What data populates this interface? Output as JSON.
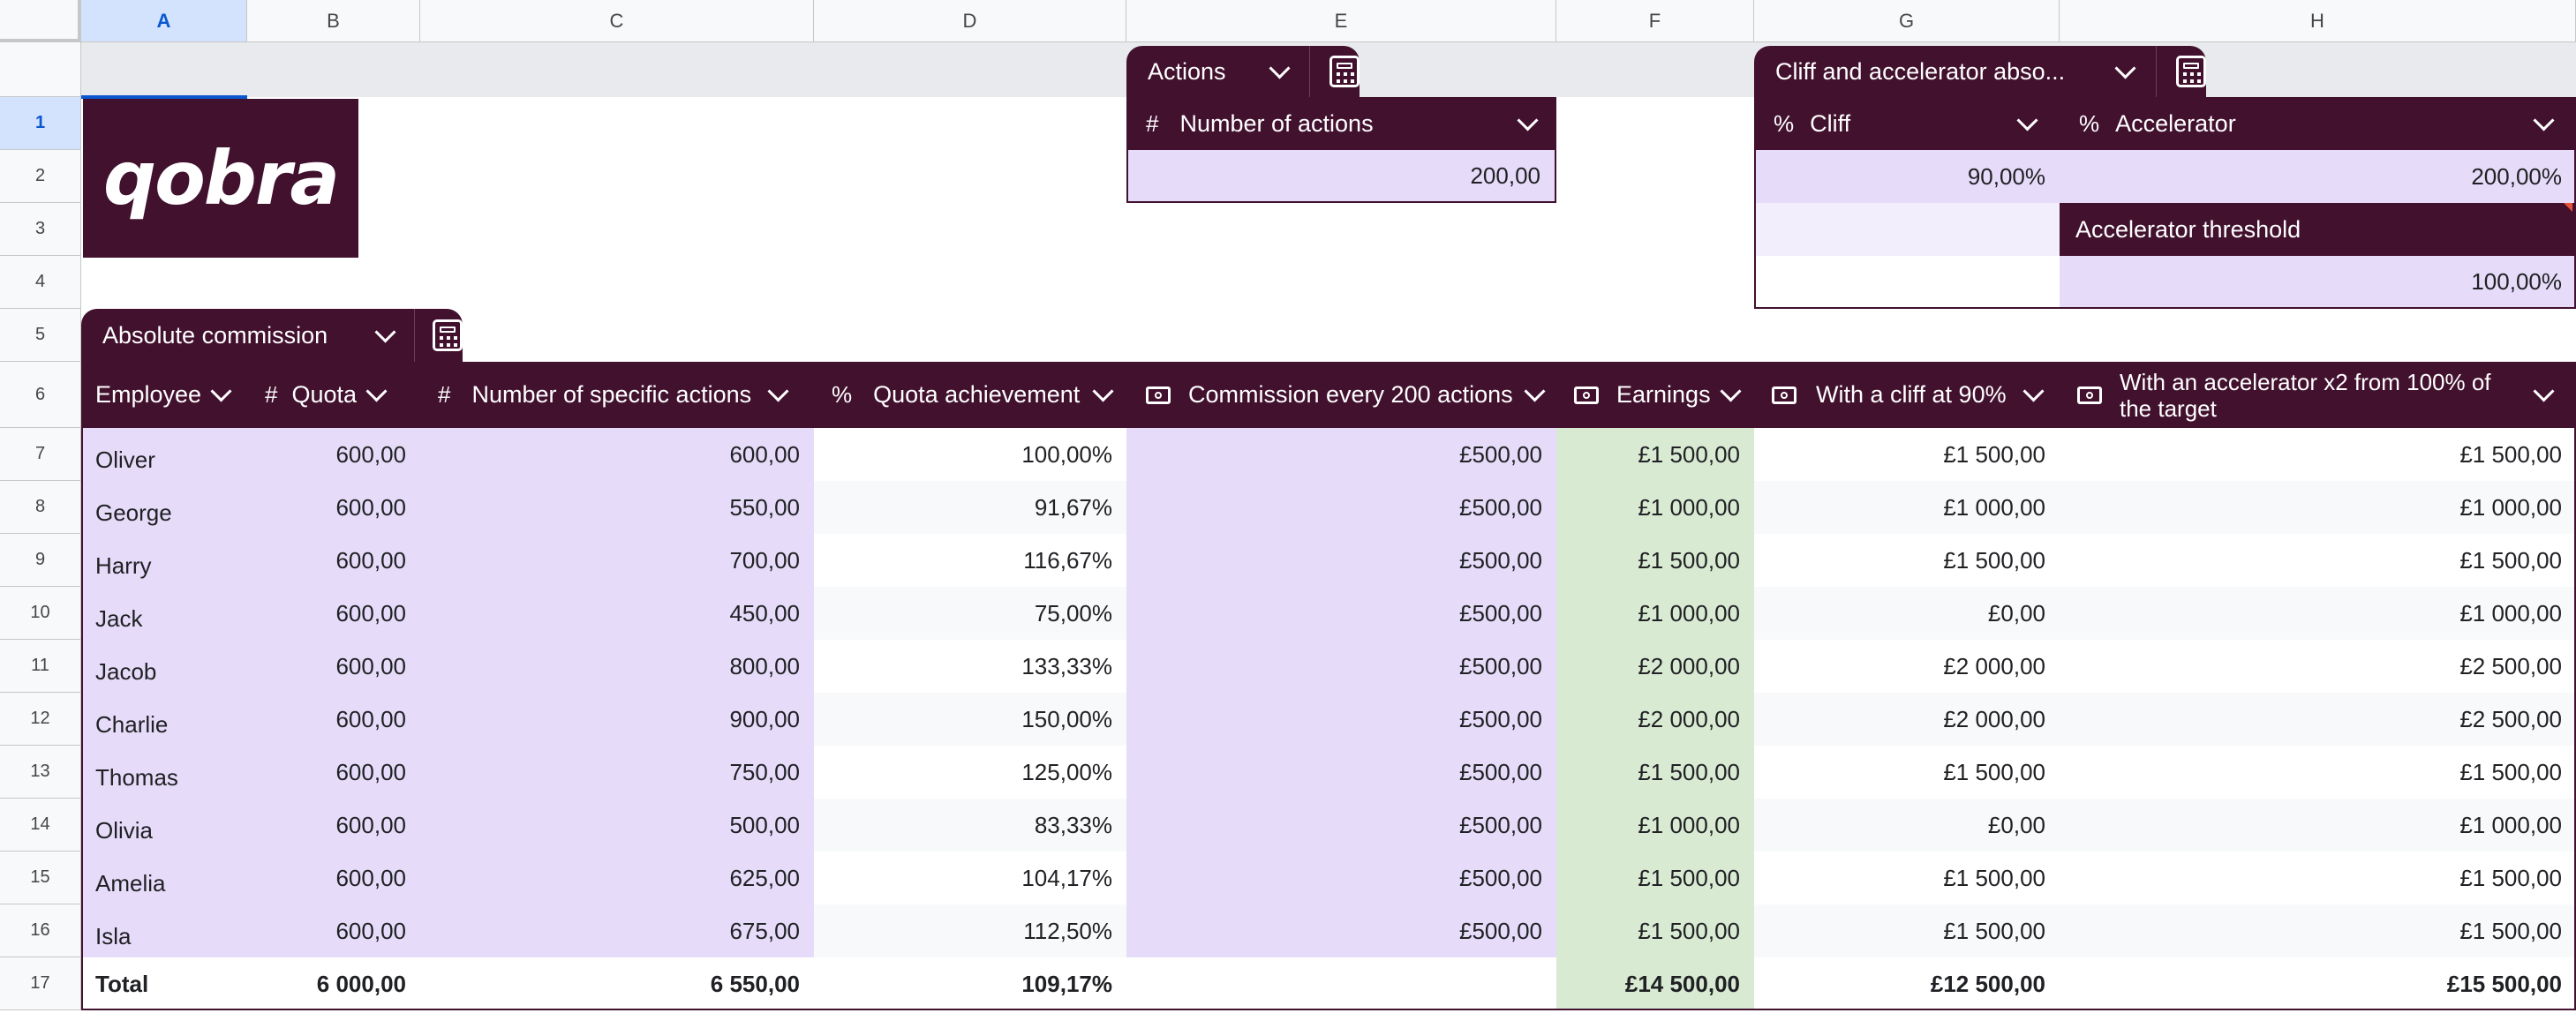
{
  "columns": [
    "A",
    "B",
    "C",
    "D",
    "E",
    "F",
    "G",
    "H"
  ],
  "rows": [
    "1",
    "2",
    "3",
    "4",
    "5",
    "6",
    "7",
    "8",
    "9",
    "10",
    "11",
    "12",
    "13",
    "14",
    "15",
    "16",
    "17"
  ],
  "logo": {
    "text": "qobra"
  },
  "actions_table": {
    "tab_label": "Actions",
    "column_header": "Number of actions",
    "value": "200,00"
  },
  "cliff_table": {
    "tab_label": "Cliff and accelerator abso...",
    "cliff_header": "Cliff",
    "cliff_value": "90,00%",
    "accelerator_header": "Accelerator",
    "accelerator_value": "200,00%",
    "threshold_header": "Accelerator threshold",
    "threshold_value": "100,00%"
  },
  "commission_table": {
    "tab_label": "Absolute commission",
    "headers": {
      "employee": "Employee",
      "quota": "Quota",
      "specific_actions": "Number of specific actions",
      "quota_achievement": "Quota achievement",
      "commission": "Commission every 200 actions",
      "earnings": "Earnings",
      "cliff": "With a cliff at 90%",
      "accelerator_line1": "With an accelerator x2 from 100% of",
      "accelerator_line2": "the target"
    },
    "icons": {
      "number": "#",
      "percent": "%",
      "money": "banknote-icon"
    },
    "rows": [
      {
        "employee": "Oliver",
        "quota": "600,00",
        "actions": "600,00",
        "achievement": "100,00%",
        "commission": "£500,00",
        "earnings": "£1 500,00",
        "cliff": "£1 500,00",
        "accelerator": "£1 500,00"
      },
      {
        "employee": "George",
        "quota": "600,00",
        "actions": "550,00",
        "achievement": "91,67%",
        "commission": "£500,00",
        "earnings": "£1 000,00",
        "cliff": "£1 000,00",
        "accelerator": "£1 000,00"
      },
      {
        "employee": "Harry",
        "quota": "600,00",
        "actions": "700,00",
        "achievement": "116,67%",
        "commission": "£500,00",
        "earnings": "£1 500,00",
        "cliff": "£1 500,00",
        "accelerator": "£1 500,00"
      },
      {
        "employee": "Jack",
        "quota": "600,00",
        "actions": "450,00",
        "achievement": "75,00%",
        "commission": "£500,00",
        "earnings": "£1 000,00",
        "cliff": "£0,00",
        "accelerator": "£1 000,00"
      },
      {
        "employee": "Jacob",
        "quota": "600,00",
        "actions": "800,00",
        "achievement": "133,33%",
        "commission": "£500,00",
        "earnings": "£2 000,00",
        "cliff": "£2 000,00",
        "accelerator": "£2 500,00"
      },
      {
        "employee": "Charlie",
        "quota": "600,00",
        "actions": "900,00",
        "achievement": "150,00%",
        "commission": "£500,00",
        "earnings": "£2 000,00",
        "cliff": "£2 000,00",
        "accelerator": "£2 500,00"
      },
      {
        "employee": "Thomas",
        "quota": "600,00",
        "actions": "750,00",
        "achievement": "125,00%",
        "commission": "£500,00",
        "earnings": "£1 500,00",
        "cliff": "£1 500,00",
        "accelerator": "£1 500,00"
      },
      {
        "employee": "Olivia",
        "quota": "600,00",
        "actions": "500,00",
        "achievement": "83,33%",
        "commission": "£500,00",
        "earnings": "£1 000,00",
        "cliff": "£0,00",
        "accelerator": "£1 000,00"
      },
      {
        "employee": "Amelia",
        "quota": "600,00",
        "actions": "625,00",
        "achievement": "104,17%",
        "commission": "£500,00",
        "earnings": "£1 500,00",
        "cliff": "£1 500,00",
        "accelerator": "£1 500,00"
      },
      {
        "employee": "Isla",
        "quota": "600,00",
        "actions": "675,00",
        "achievement": "112,50%",
        "commission": "£500,00",
        "earnings": "£1 500,00",
        "cliff": "£1 500,00",
        "accelerator": "£1 500,00"
      }
    ],
    "total": {
      "employee": "Total",
      "quota": "6 000,00",
      "actions": "6 550,00",
      "achievement": "109,17%",
      "earnings": "£14 500,00",
      "cliff": "£12 500,00",
      "accelerator": "£15 500,00"
    }
  },
  "colors": {
    "header_purple": "#42112e",
    "input_lavender": "#e6dcfa",
    "earnings_green": "#d9ead3",
    "selection_blue": "#d3e3fd"
  }
}
